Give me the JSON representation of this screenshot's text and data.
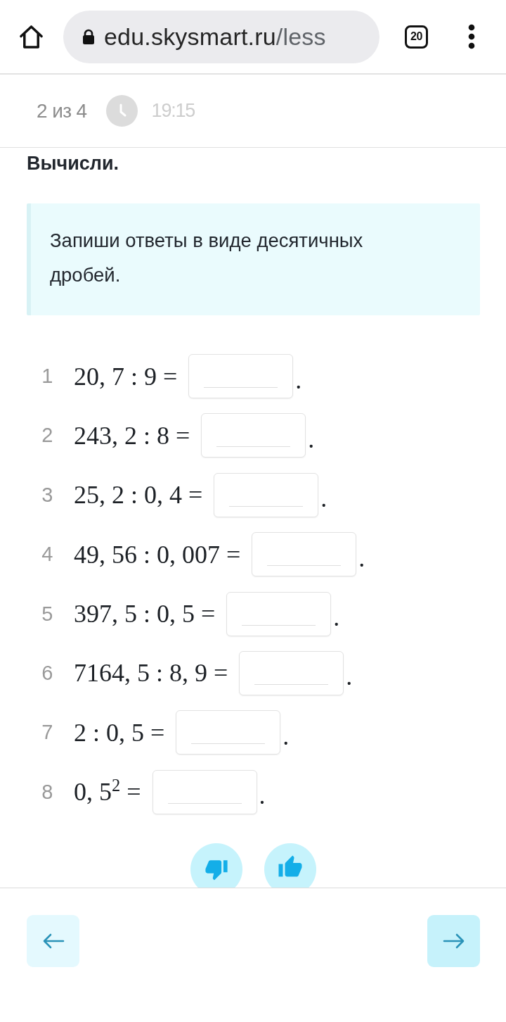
{
  "browser": {
    "url_host": "edu.skysmart.ru",
    "url_path": "/less",
    "tab_count": "20"
  },
  "progress": {
    "position": "2 из 4",
    "timer": "19:15"
  },
  "task": {
    "title": "Вычисли.",
    "hint": "Запиши ответы в виде десятичных дробей."
  },
  "exercises": [
    {
      "number": "1",
      "expression": "20, 7 : 9 =",
      "suffix": "."
    },
    {
      "number": "2",
      "expression": "243, 2 : 8 =",
      "suffix": "."
    },
    {
      "number": "3",
      "expression": "25, 2 : 0, 4 =",
      "suffix": "."
    },
    {
      "number": "4",
      "expression": "49, 56 : 0, 007 =",
      "suffix": "."
    },
    {
      "number": "5",
      "expression": "397, 5 : 0, 5 =",
      "suffix": "."
    },
    {
      "number": "6",
      "expression": "7164, 5 : 8, 9 =",
      "suffix": "."
    },
    {
      "number": "7",
      "expression": "2 : 0, 5 =",
      "suffix": "."
    },
    {
      "number": "8",
      "expression": "0, 5$^{2}$ =",
      "suffix": "."
    }
  ]
}
